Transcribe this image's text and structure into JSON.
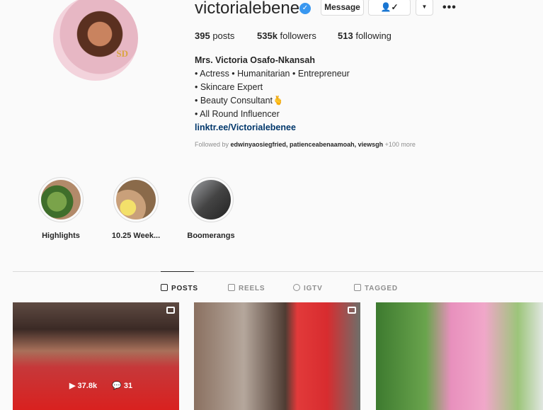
{
  "profile": {
    "username": "victorialebenee",
    "verified_icon": "verified-badge-icon",
    "message_label": "Message",
    "follow_icon": "person-check-icon",
    "dropdown_icon": "chevron-down-icon",
    "more_icon": "more-horizontal-icon",
    "more_glyph": "•••",
    "dropdown_glyph": "▼",
    "follow_glyph": "👤✓",
    "avatar_logo": "SD",
    "posts_count": "395",
    "posts_label": "posts",
    "followers_count": "535k",
    "followers_label": "followers",
    "following_count": "513",
    "following_label": "following"
  },
  "bio": {
    "name": "Mrs. Victoria Osafo-Nkansah",
    "lines": [
      "• Actress • Humanitarian • Entrepreneur",
      "• Skincare Expert",
      "• Beauty Consultant🫰",
      "• All Round Influencer"
    ],
    "link": "linktr.ee/Victorialebenee",
    "followed_prefix": "Followed by ",
    "followed_names": "edwinyaosiegfried, patienceabenaamoah, viewsgh",
    "followed_more": " +100 more"
  },
  "highlights": [
    {
      "label": "Highlights"
    },
    {
      "label": "10.25 Week..."
    },
    {
      "label": "Boomerangs"
    }
  ],
  "tabs": [
    {
      "label": "POSTS",
      "active": true
    },
    {
      "label": "REELS",
      "active": false
    },
    {
      "label": "IGTV",
      "active": false
    },
    {
      "label": "TAGGED",
      "active": false
    }
  ],
  "posts": [
    {
      "likes": "37.8k",
      "comments": "31"
    }
  ],
  "colors": {
    "link": "#00376b",
    "verified": "#3897f0",
    "muted": "#8e8e8e",
    "border": "#dbdbdb"
  }
}
